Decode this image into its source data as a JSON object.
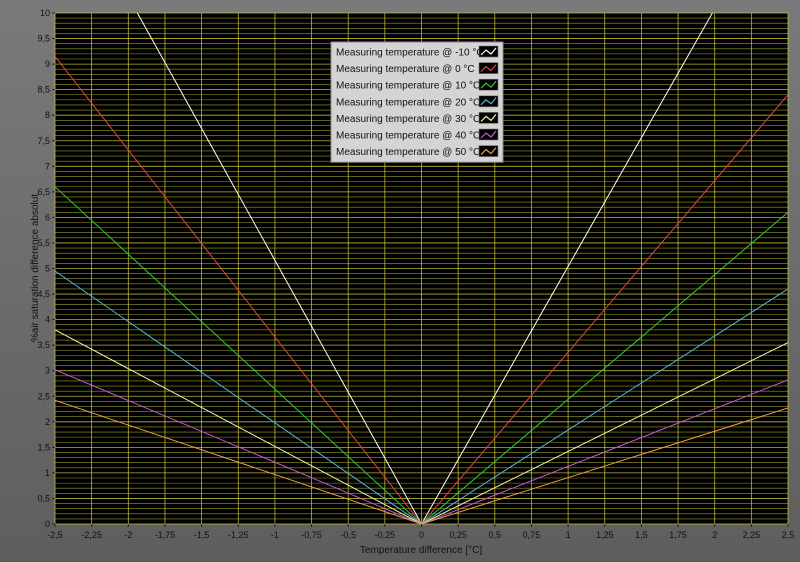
{
  "chart_data": {
    "type": "line",
    "xlabel": "Temperature difference [°C]",
    "ylabel": "%air saturation difference absolut",
    "xlim": [
      -2.5,
      2.5
    ],
    "ylim": [
      0,
      10
    ],
    "x_ticks": [
      "-2,5",
      "-2,25",
      "-2",
      "-1,75",
      "-1,5",
      "-1,25",
      "-1",
      "-0,75",
      "-0,5",
      "-0,25",
      "0",
      "0,25",
      "0,5",
      "0,75",
      "1",
      "1,25",
      "1,5",
      "1,75",
      "2",
      "2,25",
      "2,5"
    ],
    "y_ticks": [
      "0",
      "0,5",
      "1",
      "1,5",
      "2",
      "2,5",
      "3",
      "3,5",
      "4",
      "4,5",
      "5",
      "5,5",
      "6",
      "6,5",
      "7",
      "7,5",
      "8",
      "8,5",
      "9",
      "9,5",
      "10"
    ],
    "grid": true,
    "legend_position": "top-center",
    "background": "#000000",
    "grid_color": "#d8d040",
    "minor_grid_color": "#9a9a2a",
    "series": [
      {
        "name": "Measuring temperature @ -10 °C",
        "color": "#ffffff",
        "x": [
          -2.5,
          0,
          2.5
        ],
        "y": [
          12.9,
          0,
          12.6
        ]
      },
      {
        "name": "Measuring temperature @ 0 °C",
        "color": "#e04a3a",
        "x": [
          -2.5,
          0,
          2.5
        ],
        "y": [
          9.15,
          0,
          8.4
        ]
      },
      {
        "name": "Measuring temperature @ 10 °C",
        "color": "#2ecc2e",
        "x": [
          -2.5,
          0,
          2.5
        ],
        "y": [
          6.6,
          0,
          6.1
        ]
      },
      {
        "name": "Measuring temperature @ 20 °C",
        "color": "#4fb8d8",
        "x": [
          -2.5,
          0,
          2.5
        ],
        "y": [
          4.95,
          0,
          4.6
        ]
      },
      {
        "name": "Measuring temperature @ 30 °C",
        "color": "#f2f2a0",
        "x": [
          -2.5,
          0,
          2.5
        ],
        "y": [
          3.8,
          0,
          3.55
        ]
      },
      {
        "name": "Measuring temperature @ 40 °C",
        "color": "#c85ad8",
        "x": [
          -2.5,
          0,
          2.5
        ],
        "y": [
          3.02,
          0,
          2.82
        ]
      },
      {
        "name": "Measuring temperature @ 50 °C",
        "color": "#e8a040",
        "x": [
          -2.5,
          0,
          2.5
        ],
        "y": [
          2.42,
          0,
          2.27
        ]
      }
    ]
  }
}
